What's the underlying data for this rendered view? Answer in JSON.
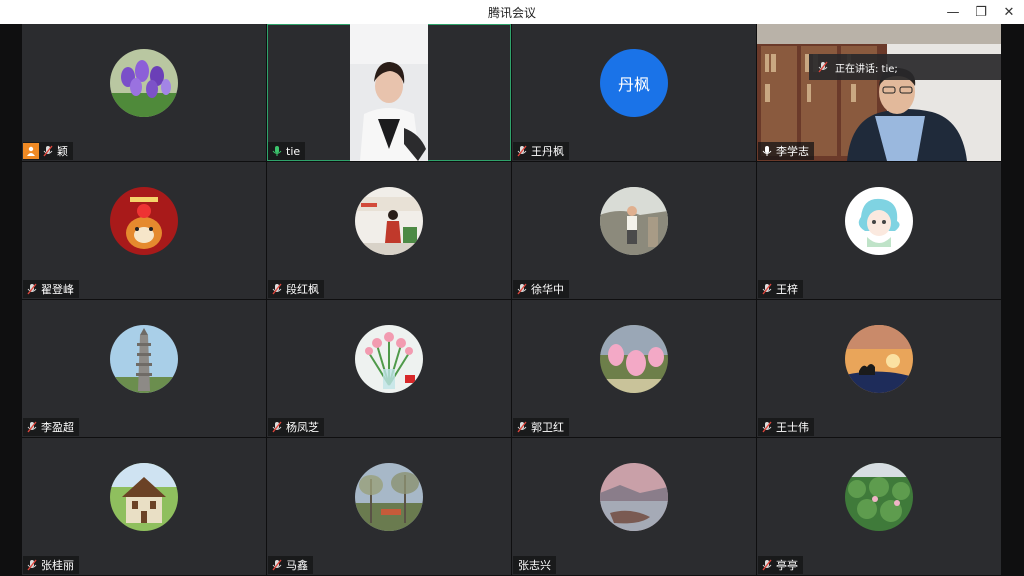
{
  "window": {
    "title": "腾讯会议"
  },
  "speaking_banner": {
    "text": "正在讲话: tie;"
  },
  "participants": [
    {
      "name": "颖"
    },
    {
      "name": "tie"
    },
    {
      "name": "王丹枫",
      "avatar_text": "丹枫"
    },
    {
      "name": "李学志"
    },
    {
      "name": "翟登峰"
    },
    {
      "name": "段红枫"
    },
    {
      "name": "徐华中"
    },
    {
      "name": "王梓"
    },
    {
      "name": "李盈超"
    },
    {
      "name": "杨凤芝"
    },
    {
      "name": "郭卫红"
    },
    {
      "name": "王士伟"
    },
    {
      "name": "张桂丽"
    },
    {
      "name": "马鑫"
    },
    {
      "name": "张志兴"
    },
    {
      "name": "亭亭"
    }
  ],
  "colors": {
    "tile_bg": "#2b2c2f",
    "active_border": "#2fa36b",
    "host_badge": "#f08a24",
    "text_avatar": "#1a73e8"
  }
}
